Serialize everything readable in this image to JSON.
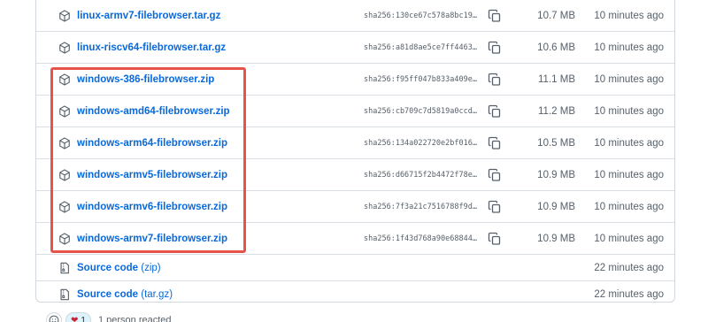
{
  "assets": [
    {
      "name": "linux-armv7-filebrowser.tar.gz",
      "sha": "sha256:130ce67c578a8bc19…",
      "size": "10.7 MB",
      "time": "10 minutes ago"
    },
    {
      "name": "linux-riscv64-filebrowser.tar.gz",
      "sha": "sha256:a81d8ae5ce7ff4463…",
      "size": "10.6 MB",
      "time": "10 minutes ago"
    },
    {
      "name": "windows-386-filebrowser.zip",
      "sha": "sha256:f95ff047b833a409e…",
      "size": "11.1 MB",
      "time": "10 minutes ago"
    },
    {
      "name": "windows-amd64-filebrowser.zip",
      "sha": "sha256:cb709c7d5819a0ccd…",
      "size": "11.2 MB",
      "time": "10 minutes ago"
    },
    {
      "name": "windows-arm64-filebrowser.zip",
      "sha": "sha256:134a022720e2bf016…",
      "size": "10.5 MB",
      "time": "10 minutes ago"
    },
    {
      "name": "windows-armv5-filebrowser.zip",
      "sha": "sha256:d66715f2b4472f78e…",
      "size": "10.9 MB",
      "time": "10 minutes ago"
    },
    {
      "name": "windows-armv6-filebrowser.zip",
      "sha": "sha256:7f3a21c7516788f9d…",
      "size": "10.9 MB",
      "time": "10 minutes ago"
    },
    {
      "name": "windows-armv7-filebrowser.zip",
      "sha": "sha256:1f43d768a90e68844…",
      "size": "10.9 MB",
      "time": "10 minutes ago"
    }
  ],
  "sources": [
    {
      "label": "Source code",
      "suffix": "(zip)",
      "time": "22 minutes ago"
    },
    {
      "label": "Source code",
      "suffix": "(tar.gz)",
      "time": "22 minutes ago"
    }
  ],
  "icons": {
    "asset": "package-icon",
    "source": "file-zip-icon",
    "copy": "copy-icon",
    "smiley": "smiley-icon",
    "heart": "heart-icon"
  },
  "reactions": {
    "heart_count": "1",
    "text": "1 person reacted"
  },
  "colors": {
    "link": "#0969da",
    "muted": "#57606a",
    "border": "#d0d7de",
    "highlight": "#e5534b"
  }
}
